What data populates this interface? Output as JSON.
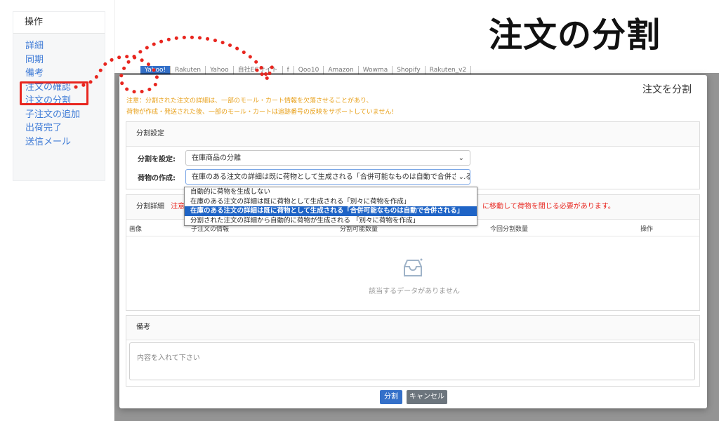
{
  "big_title": "注文の分割",
  "sidebar": {
    "header": "操作",
    "links": [
      "詳細",
      "同期",
      "備考",
      "注文の確認",
      "注文の分割",
      "子注文の追加",
      "出荷完了",
      "送信メール"
    ]
  },
  "bg_tabs": [
    "Yahoo!",
    "Rakuten",
    "Yahoo",
    "自社ECサイト",
    "f",
    "Qoo10",
    "Amazon",
    "Wowma",
    "Shopify",
    "Rakuten_v2"
  ],
  "modal": {
    "title": "注文を分割",
    "warning_line1": "注意：分割された注文の詳細は、一部のモール・カート情報を欠落させることがあり、",
    "warning_line2": "荷物が作成・発送された後、一部のモール・カートは追跡番号の反映をサポートしていません!",
    "settings": {
      "header": "分割設定",
      "split_label": "分割を設定:",
      "split_value": "在庫商品の分離",
      "package_label": "荷物の作成:",
      "package_value": "在庫のある注文の詳細は既に荷物として生成される「合併可能なものは自動で合併されるこ",
      "options": [
        "自動的に荷物を生成しない",
        "在庫のある注文の詳細は既に荷物として生成される「別々に荷物を作成」",
        "在庫のある注文の詳細は既に荷物として生成される「合併可能なものは自動で合併される」",
        "分割された注文の詳細から自動的に荷物が生成される 「別々に荷物を作成」"
      ],
      "selected_index": 2
    },
    "details": {
      "header": "分割詳細",
      "note_prefix": "注意",
      "note_suffix": "に移動して荷物を閉じる必要があります。",
      "columns": [
        "画像",
        "子注文の情報",
        "分割可能数量",
        "今回分割数量",
        "操作"
      ],
      "empty_text": "該当するデータがありません"
    },
    "notes": {
      "header": "備考",
      "placeholder": "内容を入れて下さい"
    },
    "buttons": {
      "split": "分割",
      "cancel": "キャンセル"
    }
  },
  "colors": {
    "accent": "#3470c9",
    "warning": "#e8a11c",
    "danger": "#e8261f",
    "selected_option": "#1f64c6"
  }
}
